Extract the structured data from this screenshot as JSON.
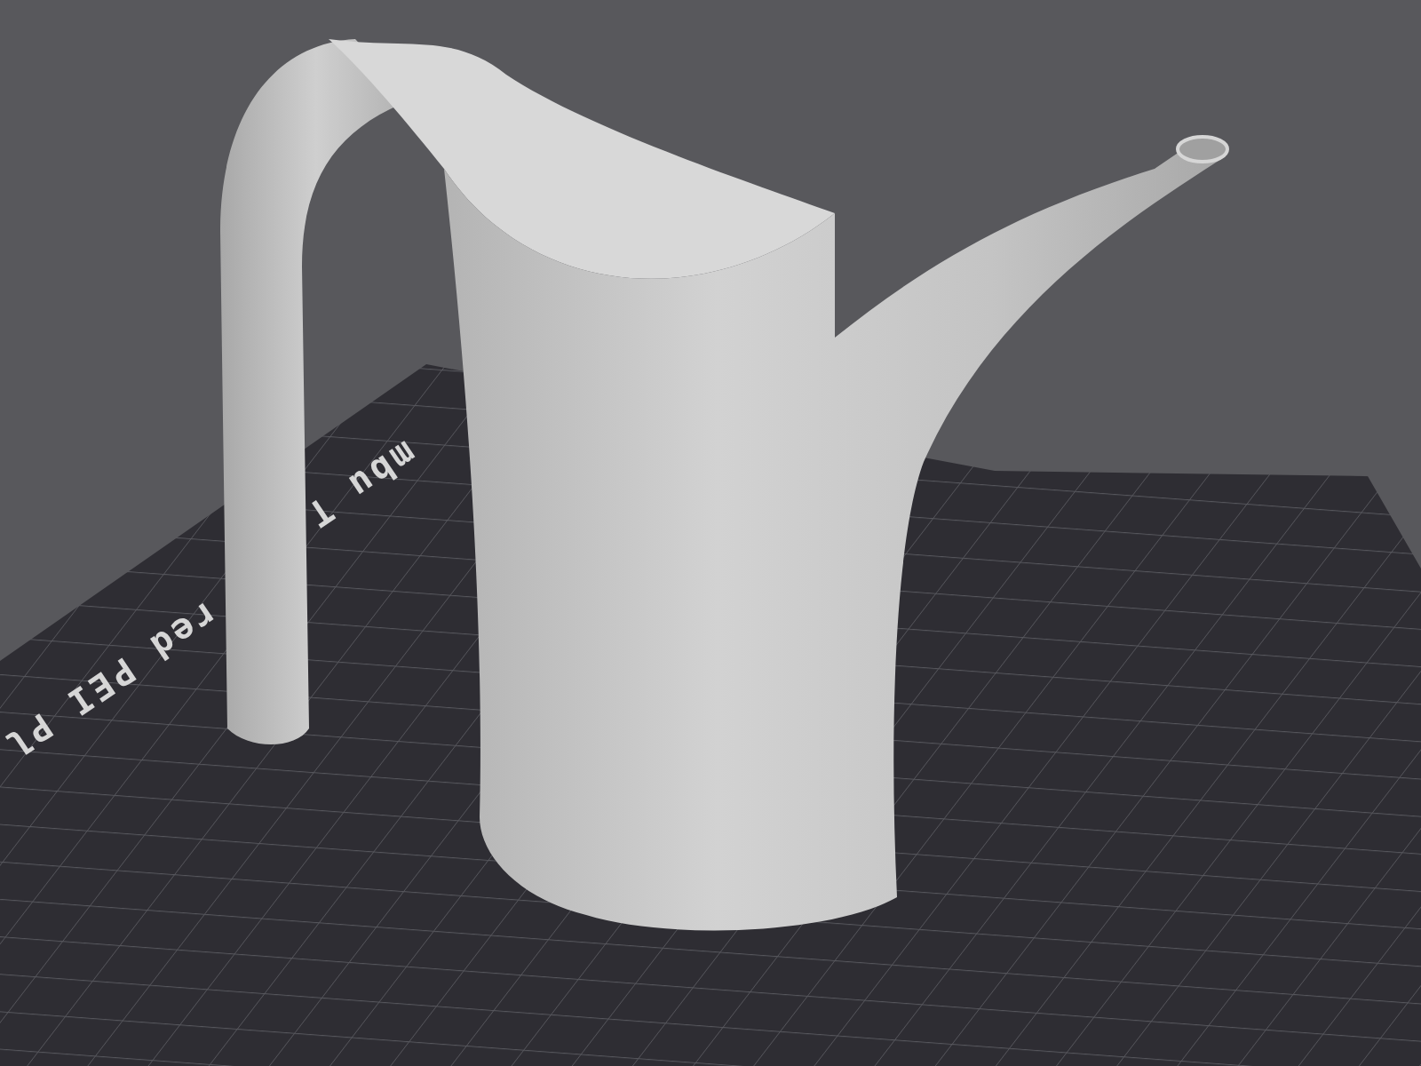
{
  "viewport": {
    "plate_labels": [
      "mbu T",
      "red PEI Pl"
    ]
  }
}
